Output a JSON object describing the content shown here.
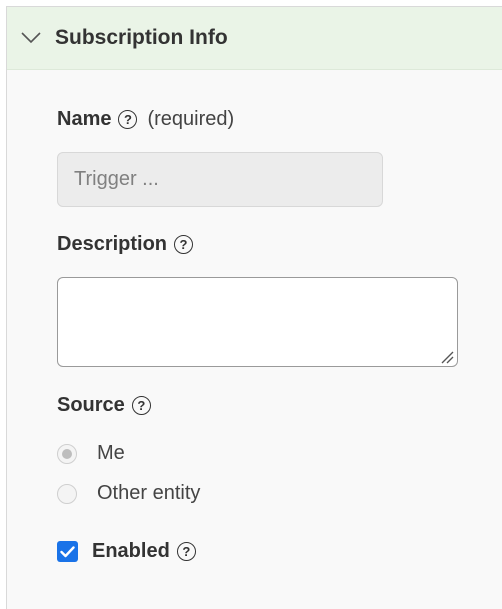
{
  "section": {
    "title": "Subscription Info"
  },
  "name_field": {
    "label": "Name",
    "required_text": "(required)",
    "placeholder": "Trigger ...",
    "help_glyph": "?"
  },
  "description_field": {
    "label": "Description",
    "value": "",
    "help_glyph": "?"
  },
  "source": {
    "label": "Source",
    "help_glyph": "?",
    "options": [
      {
        "label": "Me",
        "selected": true,
        "disabled": true
      },
      {
        "label": "Other entity",
        "selected": false,
        "disabled": true
      }
    ]
  },
  "enabled": {
    "label": "Enabled",
    "checked": true,
    "help_glyph": "?"
  },
  "colors": {
    "header_bg": "#eaf4e7",
    "panel_bg": "#f9f9f9",
    "checkbox_accent": "#1a73e8"
  },
  "icons": {
    "collapse": "chevron-down-icon",
    "help": "question-circle-icon",
    "check": "check-icon",
    "resize": "resize-grip-icon"
  }
}
